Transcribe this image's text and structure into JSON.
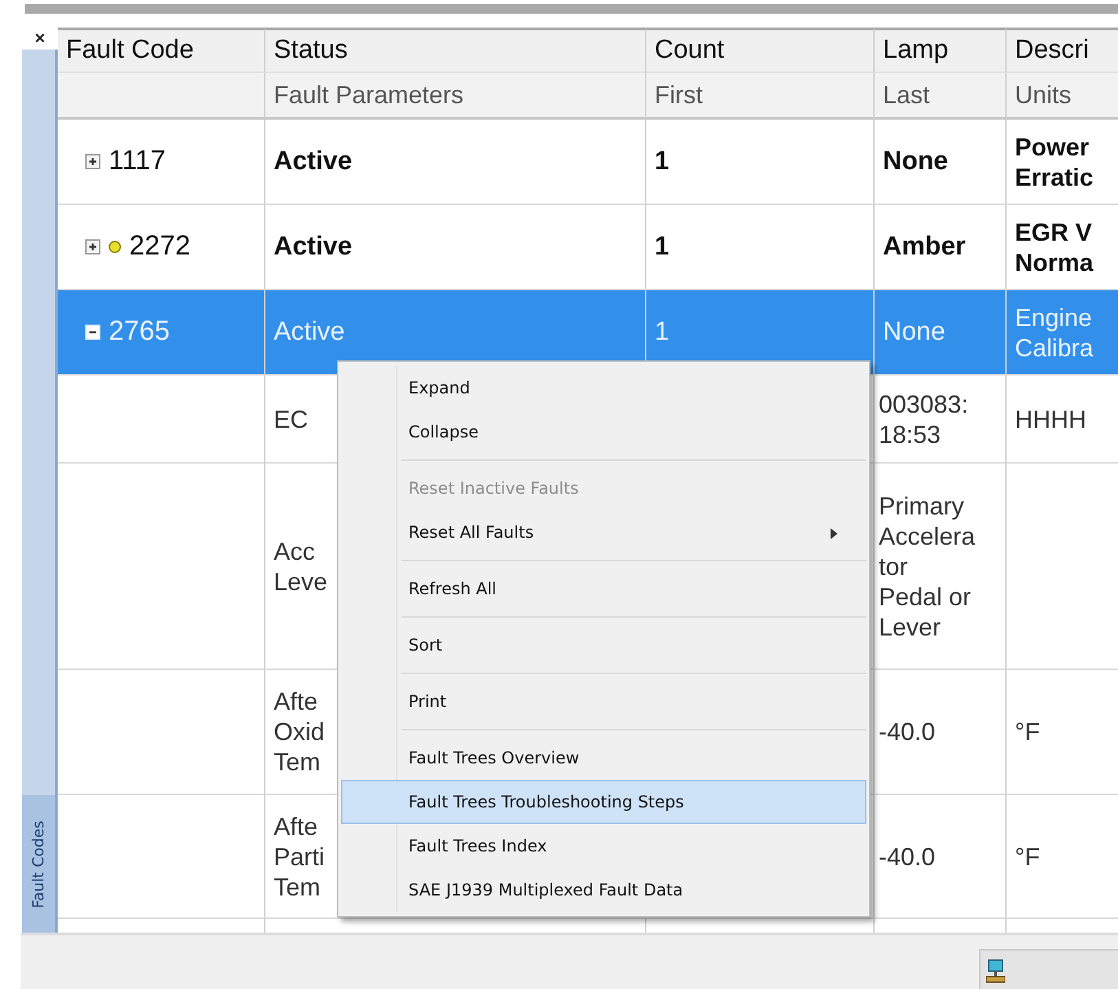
{
  "panel": {
    "close": "×",
    "tab_label": "Fault Codes"
  },
  "columns": [
    {
      "label": "Fault Code"
    },
    {
      "label": "Status",
      "sublabel": "Fault Parameters"
    },
    {
      "label": "Count",
      "sublabel": "First"
    },
    {
      "label": "Lamp",
      "sublabel": "Last"
    },
    {
      "label": "Descri",
      "sublabel": "Units"
    }
  ],
  "rows": [
    {
      "code": "1117",
      "expanded": false,
      "selected": false,
      "status": "Active",
      "count": "1",
      "lamp": "None",
      "description": [
        "Power",
        "Erratic"
      ]
    },
    {
      "code": "2272",
      "color": "#e6e030",
      "expanded": false,
      "selected": false,
      "status": "Active",
      "count": "1",
      "lamp": "Amber",
      "description": [
        "EGR V",
        "Norma"
      ]
    },
    {
      "code": "2765",
      "expanded": true,
      "selected": true,
      "status": "Active",
      "count": "1",
      "lamp": "None",
      "description": [
        "Engine",
        "Calibra"
      ]
    }
  ],
  "detail_rows": [
    {
      "parameter": [
        "EC"
      ],
      "last": [
        "003083:",
        "18:53"
      ],
      "units": "HHHH"
    },
    {
      "parameter": [
        "Acc",
        "Leve"
      ],
      "last": [
        "Primary",
        "Accelera",
        "tor",
        "Pedal or",
        "Lever"
      ],
      "units": ""
    },
    {
      "parameter": [
        "Afte",
        "Oxid",
        "Tem"
      ],
      "last": [
        "-40.0"
      ],
      "units": "°F"
    },
    {
      "parameter": [
        "Afte",
        "Parti",
        "Tem"
      ],
      "last": [
        "-40.0"
      ],
      "units": "°F"
    }
  ],
  "context_menu": {
    "groups": [
      [
        {
          "label": "Expand",
          "disabled": false,
          "selected": false,
          "submenu": false
        },
        {
          "label": "Collapse",
          "disabled": false,
          "selected": false,
          "submenu": false
        }
      ],
      [
        {
          "label": "Reset Inactive Faults",
          "disabled": true,
          "selected": false,
          "submenu": false
        },
        {
          "label": "Reset All Faults",
          "disabled": false,
          "selected": false,
          "submenu": true
        }
      ],
      [
        {
          "label": "Refresh All",
          "disabled": false,
          "selected": false,
          "submenu": false
        }
      ],
      [
        {
          "label": "Sort",
          "disabled": false,
          "selected": false,
          "submenu": false
        }
      ],
      [
        {
          "label": "Print",
          "disabled": false,
          "selected": false,
          "submenu": false
        }
      ],
      [
        {
          "label": "Fault Trees Overview",
          "disabled": false,
          "selected": false,
          "submenu": false
        },
        {
          "label": "Fault Trees Troubleshooting Steps",
          "disabled": false,
          "selected": true,
          "submenu": false
        },
        {
          "label": "Fault Trees Index",
          "disabled": false,
          "selected": false,
          "submenu": false
        },
        {
          "label": "SAE J1939 Multiplexed Fault Data",
          "disabled": false,
          "selected": false,
          "submenu": false
        }
      ]
    ]
  }
}
